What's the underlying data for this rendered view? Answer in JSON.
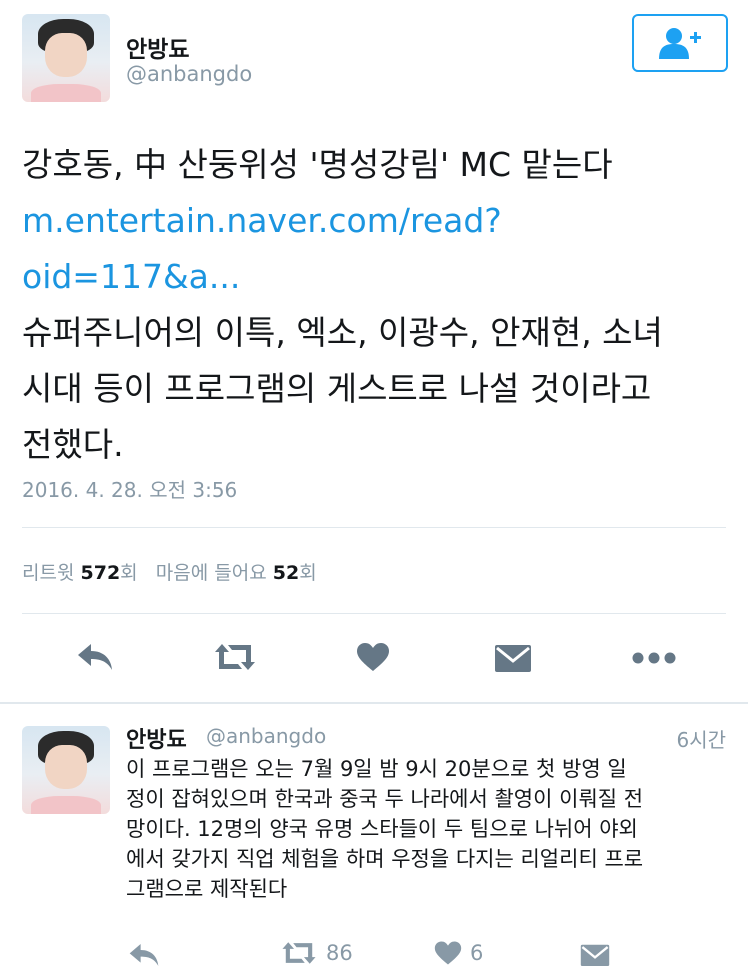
{
  "tweet": {
    "user": {
      "display_name": "안방됴",
      "handle": "@anbangdo",
      "avatar_icon": "profile-avatar"
    },
    "follow_button": {
      "icon": "add-user-icon",
      "accent": "#1da1f2"
    },
    "text_lines": [
      "강호동, 中 산둥위성 '명성강림' MC 맡는다",
      "m.entertain.naver.com/read?",
      "oid=117&a...",
      "슈퍼주니어의 이특, 엑소, 이광수, 안재현, 소녀",
      "시대 등이 프로그램의 게스트로 나설 것이라고",
      "전했다."
    ],
    "timestamp": "2016. 4. 28. 오전 3:56",
    "stats": {
      "retweet_label": "리트윗",
      "retweet_count": "572",
      "retweet_unit": "회",
      "like_label": "마음에 들어요",
      "like_count": "52",
      "like_unit": "회"
    },
    "actions": [
      "reply-icon",
      "retweet-icon",
      "heart-icon",
      "message-icon",
      "more-icon"
    ],
    "link_color": "#1b95e0"
  },
  "reply": {
    "user": {
      "display_name": "안방됴",
      "handle": "@anbangdo"
    },
    "time": "6시간",
    "text_lines": [
      "이 프로그램은 오는 7월 9일 밤 9시 20분으로 첫 방영 일",
      "정이 잡혀있으며 한국과 중국 두 나라에서 촬영이 이뤄질 전",
      "망이다. 12명의 양국 유명 스타들이 두 팀으로 나뉘어 야외",
      "에서 갖가지 직업 체험을 하며 우정을 다지는 리얼리티 프로",
      "그램으로 제작된다"
    ],
    "retweet_count": "86",
    "like_count": "6"
  }
}
